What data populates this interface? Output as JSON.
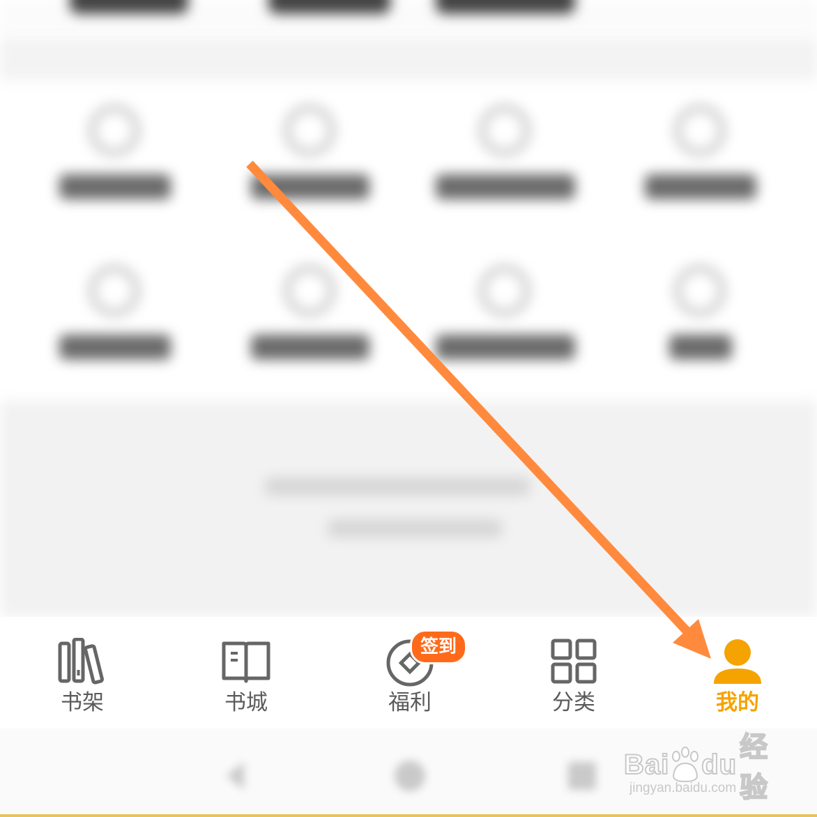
{
  "tab_bar": {
    "items": [
      {
        "label": "书架",
        "icon": "bookshelf-icon",
        "active": false
      },
      {
        "label": "书城",
        "icon": "open-book-icon",
        "active": false
      },
      {
        "label": "福利",
        "icon": "coin-icon",
        "active": false,
        "badge": "签到"
      },
      {
        "label": "分类",
        "icon": "grid-icon",
        "active": false
      },
      {
        "label": "我的",
        "icon": "person-icon",
        "active": true
      }
    ]
  },
  "system_nav": {
    "buttons": [
      "back-icon",
      "home-icon",
      "recents-icon"
    ]
  },
  "watermark": {
    "logo_text_1": "Bai",
    "logo_text_2": "du",
    "logo_text_3": "经验",
    "url": "jingyan.baidu.com"
  },
  "annotation": {
    "type": "arrow",
    "color": "#ff8a3d",
    "target": "我的"
  },
  "colors": {
    "active_tab": "#f5a300",
    "inactive_tab": "#5b5b5b",
    "badge": "#ff6a1a"
  }
}
